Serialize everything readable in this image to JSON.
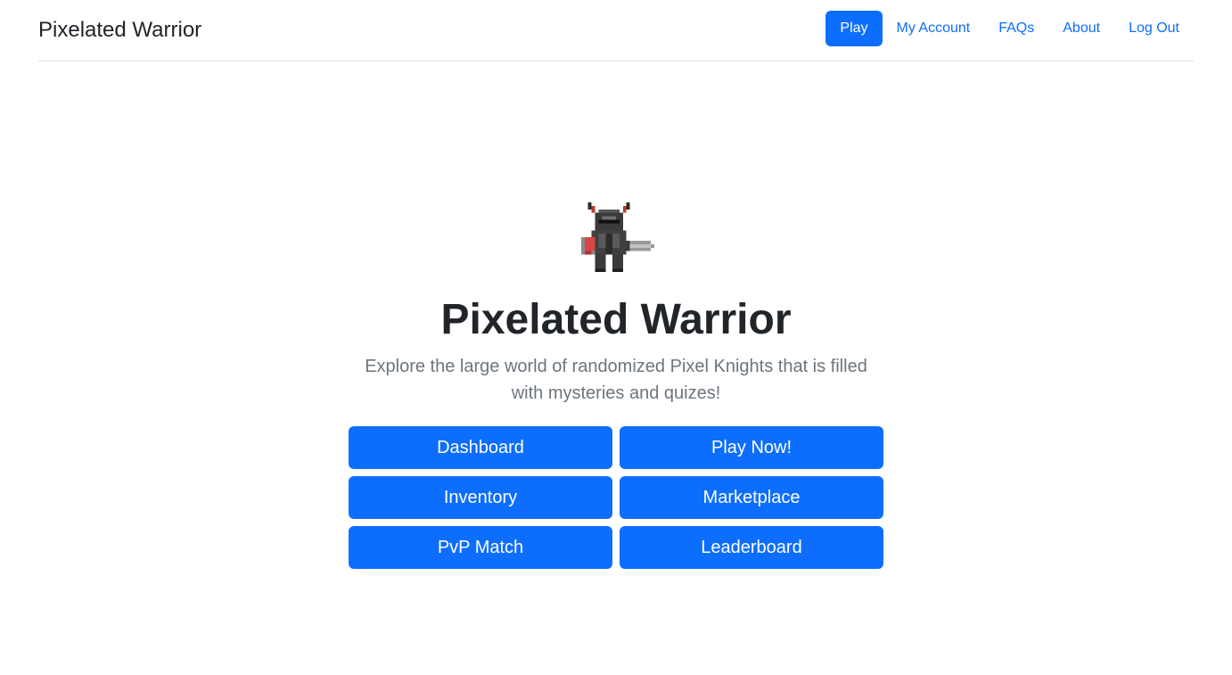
{
  "header": {
    "brand": "Pixelated Warrior",
    "nav": [
      {
        "label": "Play",
        "active": true
      },
      {
        "label": "My Account",
        "active": false
      },
      {
        "label": "FAQs",
        "active": false
      },
      {
        "label": "About",
        "active": false
      },
      {
        "label": "Log Out",
        "active": false
      }
    ]
  },
  "hero": {
    "image_icon": "pixel-knight-icon",
    "title": "Pixelated Warrior",
    "lead": "Explore the large world of randomized Pixel Knights that is filled with mysteries and quizes!",
    "buttons": [
      {
        "label": "Dashboard"
      },
      {
        "label": "Play Now!"
      },
      {
        "label": "Inventory"
      },
      {
        "label": "Marketplace"
      },
      {
        "label": "PvP Match"
      },
      {
        "label": "Leaderboard"
      }
    ]
  },
  "colors": {
    "primary": "#0d6efd",
    "text": "#212529",
    "muted": "#6c757d"
  }
}
